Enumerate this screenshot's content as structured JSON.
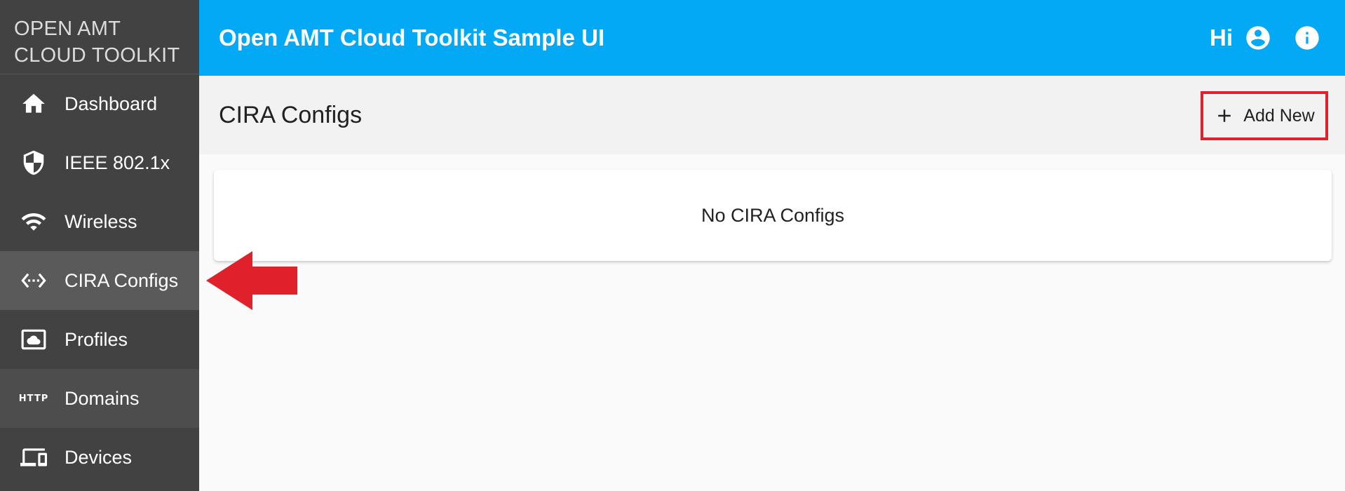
{
  "brand": {
    "line1": "OPEN AMT",
    "line2": "CLOUD TOOLKIT"
  },
  "sidebar": {
    "items": [
      {
        "label": "Dashboard",
        "icon": "home-icon"
      },
      {
        "label": "IEEE 802.1x",
        "icon": "shield-icon"
      },
      {
        "label": "Wireless",
        "icon": "wifi-icon"
      },
      {
        "label": "CIRA Configs",
        "icon": "settings-ethernet-icon",
        "active": true
      },
      {
        "label": "Profiles",
        "icon": "cloud-profile-icon"
      },
      {
        "label": "Domains",
        "icon": "http-icon",
        "icon_text": "HTTP"
      },
      {
        "label": "Devices",
        "icon": "devices-icon"
      }
    ]
  },
  "header": {
    "title": "Open AMT Cloud Toolkit Sample UI",
    "greeting": "Hi"
  },
  "page": {
    "title": "CIRA Configs",
    "add_button_label": "Add New",
    "empty_message": "No CIRA Configs"
  },
  "colors": {
    "header_bg": "#03a9f4",
    "sidebar_bg": "#424242",
    "sidebar_active": "#5a5a5a",
    "annotation_red": "#e0202a"
  }
}
